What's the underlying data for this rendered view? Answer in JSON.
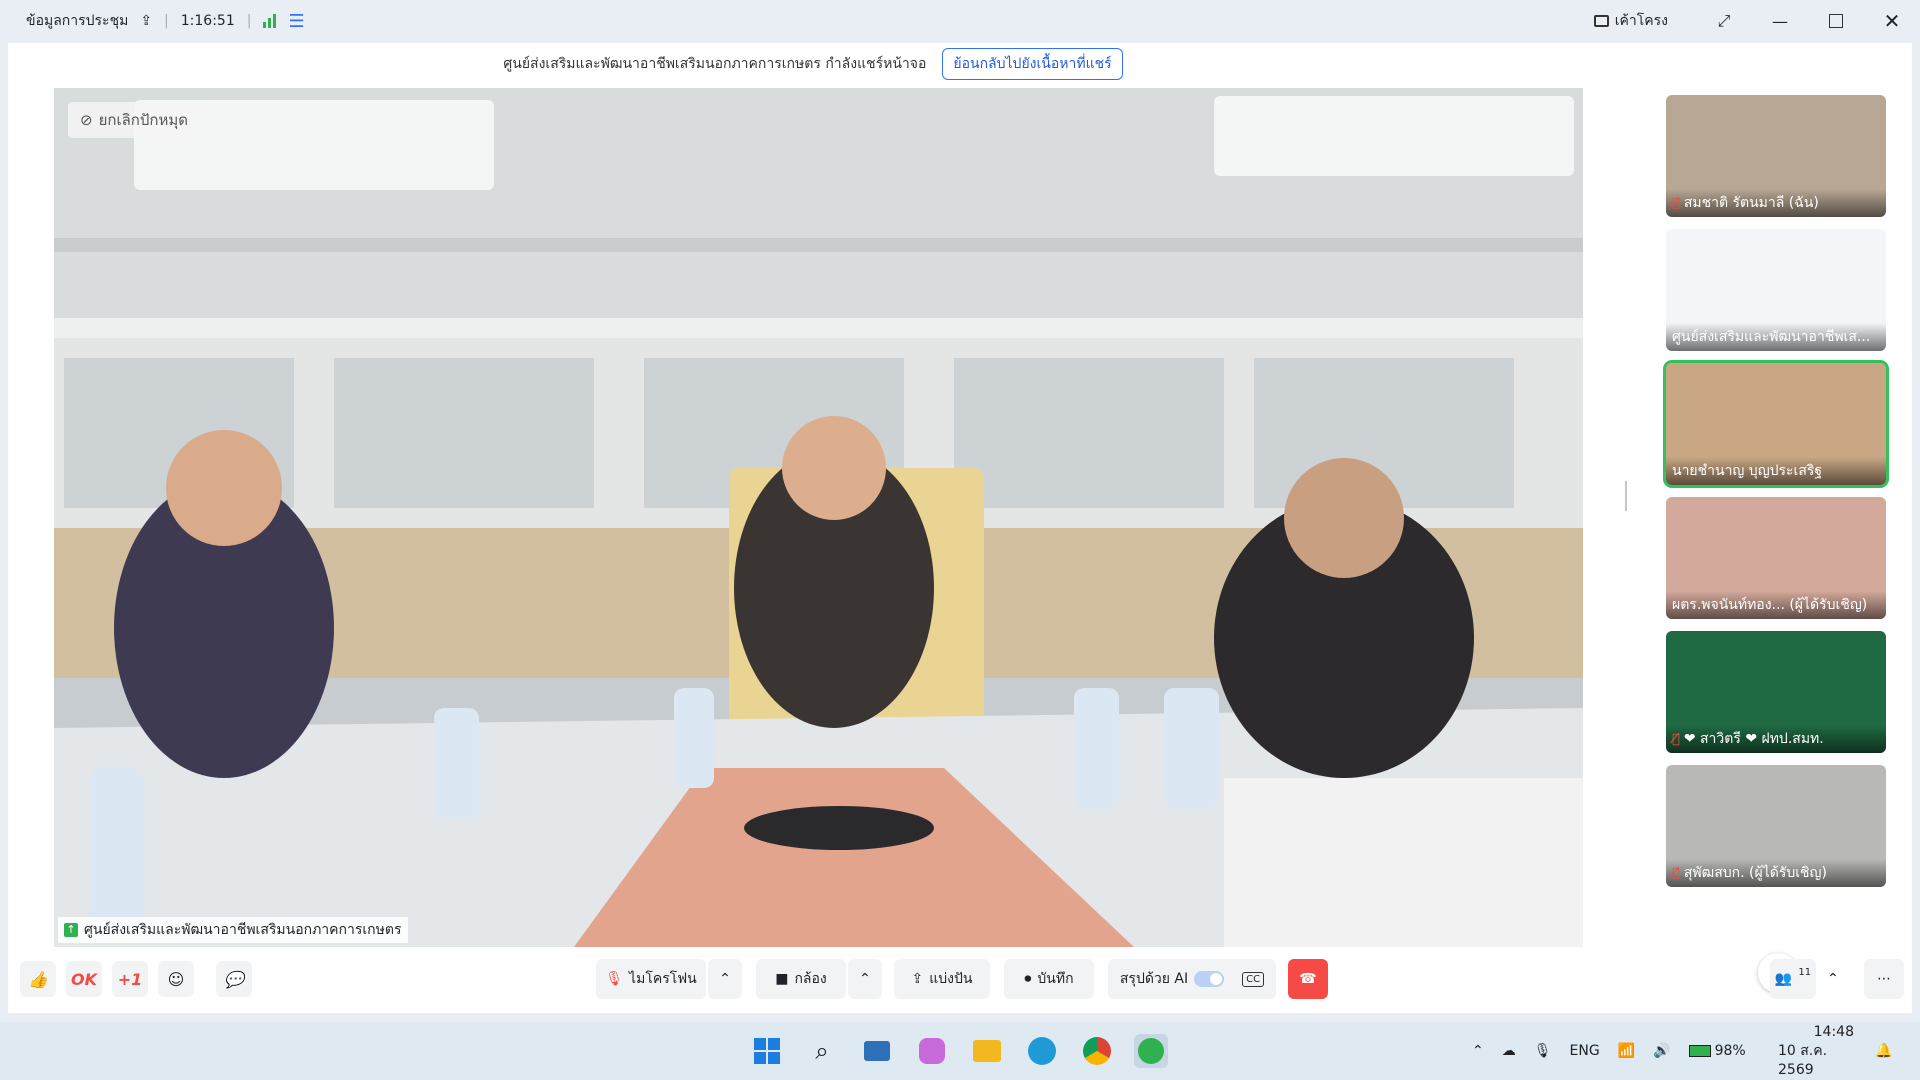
{
  "topbar": {
    "meeting_info": "ข้อมูลการประชุม",
    "timer": "1:16:51",
    "layout_label": "เค้าโครง"
  },
  "banner": {
    "text": "ศูนย์ส่งเสริมและพัฒนาอาชีพเสริมนอกภาคการเกษตร กำลังแชร์หน้าจอ",
    "back_button": "ย้อนกลับไปยังเนื้อหาที่แชร์"
  },
  "main_video": {
    "unpin_label": "ยกเลิกปักหมุด",
    "label": "ศูนย์ส่งเสริมและพัฒนาอาชีพเสริมนอกภาคการเกษตร"
  },
  "participants": [
    {
      "name": "สมชาติ รัตนมาลี (ฉัน)",
      "muted": true
    },
    {
      "name": "ศูนย์ส่งเสริมและพัฒนาอาชีพเส...",
      "muted": false
    },
    {
      "name": "นายชำนาญ บุญประเสริฐ",
      "muted": false
    },
    {
      "name": "ผตร.พจนันท์ทอง... (ผู้ได้รับเชิญ)",
      "muted": false
    },
    {
      "name": "❤ สาวิตรี ❤ ฝทป.สมท.",
      "muted": true
    },
    {
      "name": "สุพัฒสบก. (ผู้ได้รับเชิญ)",
      "muted": true
    }
  ],
  "controls": {
    "reaction_ok": "OK",
    "reaction_plus": "+1",
    "mic": "ไมโครโฟน",
    "camera": "กล้อง",
    "share": "แบ่งปัน",
    "record": "บันทึก",
    "ai_summary": "สรุปด้วย AI",
    "cc": "CC",
    "participant_count": "11"
  },
  "taskbar": {
    "lang": "ENG",
    "battery": "98%",
    "time": "14:48",
    "date": "10 ส.ค. 2569"
  }
}
